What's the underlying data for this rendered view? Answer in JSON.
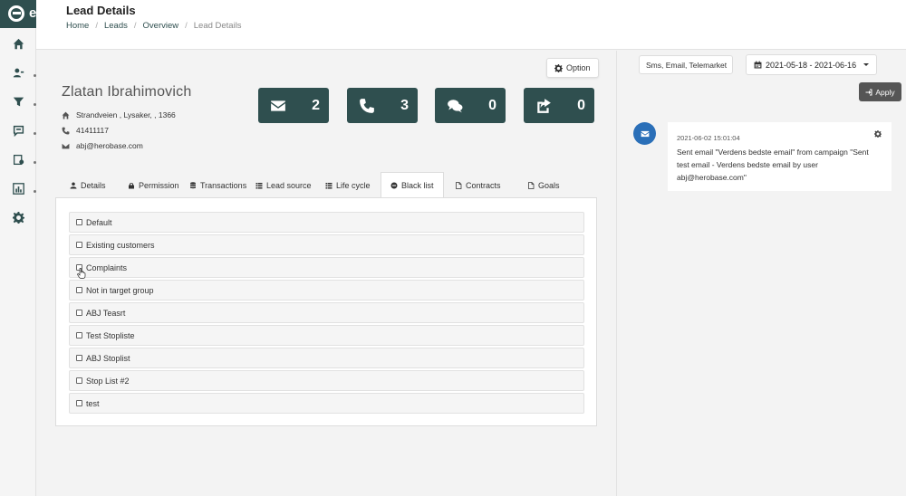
{
  "app": {
    "logo_letter": "e"
  },
  "header": {
    "title": "Lead Details",
    "breadcrumb": [
      "Home",
      "Leads",
      "Overview",
      "Lead Details"
    ]
  },
  "sidebar": {
    "items": [
      {
        "icon": "home-icon"
      },
      {
        "icon": "users-icon"
      },
      {
        "icon": "filter-icon"
      },
      {
        "icon": "feedback-icon"
      },
      {
        "icon": "campaign-icon"
      },
      {
        "icon": "reports-icon"
      },
      {
        "icon": "gear-icon"
      }
    ]
  },
  "lead": {
    "option_label": "Option",
    "name": "Zlatan Ibrahimovich",
    "address": "Strandveien , Lysaker, , 1366",
    "phone": "41411117",
    "email": "abj@herobase.com"
  },
  "stats": [
    {
      "icon": "envelope-icon",
      "value": "2"
    },
    {
      "icon": "phone-icon",
      "value": "3"
    },
    {
      "icon": "comments-icon",
      "value": "0"
    },
    {
      "icon": "share-icon",
      "value": "0"
    }
  ],
  "tabs": [
    {
      "label": "Details",
      "icon": "user-icon"
    },
    {
      "label": "Permission",
      "icon": "lock-icon"
    },
    {
      "label": "Transactions",
      "icon": "database-icon"
    },
    {
      "label": "Lead source",
      "icon": "list-icon"
    },
    {
      "label": "Life cycle",
      "icon": "list-icon"
    },
    {
      "label": "Black list",
      "icon": "minus-circle-icon",
      "active": true
    },
    {
      "label": "Contracts",
      "icon": "file-icon"
    },
    {
      "label": "Goals",
      "icon": "file-icon"
    }
  ],
  "blacklist": [
    "Default",
    "Existing customers",
    "Complaints",
    "Not in target group",
    "ABJ Teasrt",
    "Test Stopliste",
    "ABJ Stoplist",
    "Stop List #2",
    "test"
  ],
  "activity": {
    "filter_value": "Sms, Email, Telemarket",
    "date_range": "2021-05-18 - 2021-06-16",
    "apply_label": "Apply",
    "entries": [
      {
        "icon": "envelope-icon",
        "time": "2021-06-02 15:01:04",
        "text": "Sent email \"Verdens bedste email\" from campaign \"Sent test email - Verdens bedste email by user abj@herobase.com\""
      }
    ]
  },
  "colors": {
    "brand": "#2f4f4f",
    "timeline_email": "#2a6fb8",
    "apply_button": "#555555"
  }
}
